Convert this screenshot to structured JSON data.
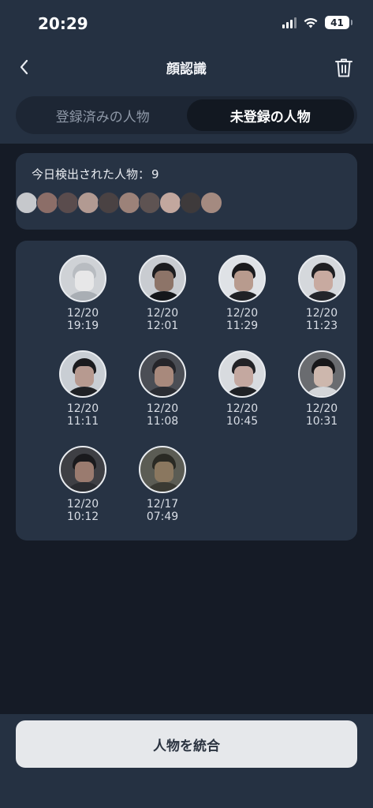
{
  "status": {
    "time": "20:29",
    "battery": "41"
  },
  "nav": {
    "title": "顔認識"
  },
  "tabs": [
    {
      "label": "登録済みの人物",
      "active": false
    },
    {
      "label": "未登録の人物",
      "active": true
    }
  ],
  "today": {
    "label": "今日検出された人物：",
    "count": "9"
  },
  "faces": [
    {
      "date": "12/20",
      "time": "19:19",
      "bg": "#cfd2d6",
      "skin": "#e7e7e8",
      "hair": "#b8bcc1",
      "body": "#a9aeb4"
    },
    {
      "date": "12/20",
      "time": "12:01",
      "bg": "#c9ccd1",
      "skin": "#8d7468",
      "hair": "#1c1c1f",
      "body": "#15171b"
    },
    {
      "date": "12/20",
      "time": "11:29",
      "bg": "#dfe2e6",
      "skin": "#b89b8e",
      "hair": "#1a1a1d",
      "body": "#202226"
    },
    {
      "date": "12/20",
      "time": "11:23",
      "bg": "#d5d8dc",
      "skin": "#c8aaa0",
      "hair": "#1f1f22",
      "body": "#23252a"
    },
    {
      "date": "12/20",
      "time": "11:11",
      "bg": "#c9ced4",
      "skin": "#b79a90",
      "hair": "#1b1b1e",
      "body": "#1f2125"
    },
    {
      "date": "12/20",
      "time": "11:08",
      "bg": "#4b4e55",
      "skin": "#a8897c",
      "hair": "#25252a",
      "body": "#2b2d33"
    },
    {
      "date": "12/20",
      "time": "10:45",
      "bg": "#d8dbdf",
      "skin": "#c4a8a0",
      "hair": "#222226",
      "body": "#1f2125"
    },
    {
      "date": "12/20",
      "time": "10:31",
      "bg": "#6a6c70",
      "skin": "#cdb7ad",
      "hair": "#17171a",
      "body": "#d4d6d9"
    },
    {
      "date": "12/20",
      "time": "10:12",
      "bg": "#3e3f44",
      "skin": "#9a7b6f",
      "hair": "#1a1a1d",
      "body": "#2a2c31"
    },
    {
      "date": "12/17",
      "time": "07:49",
      "bg": "#5b5c54",
      "skin": "#8a775f",
      "hair": "#2a2a24",
      "body": "#3a3a33"
    }
  ],
  "strip_colors": [
    "#c6c8cc",
    "#8c6e68",
    "#5a4c4d",
    "#b29a92",
    "#4a4243",
    "#9c8279",
    "#5e5352",
    "#c2a79e",
    "#3e3a3b",
    "#a48a80"
  ],
  "merge_button": "人物を統合"
}
